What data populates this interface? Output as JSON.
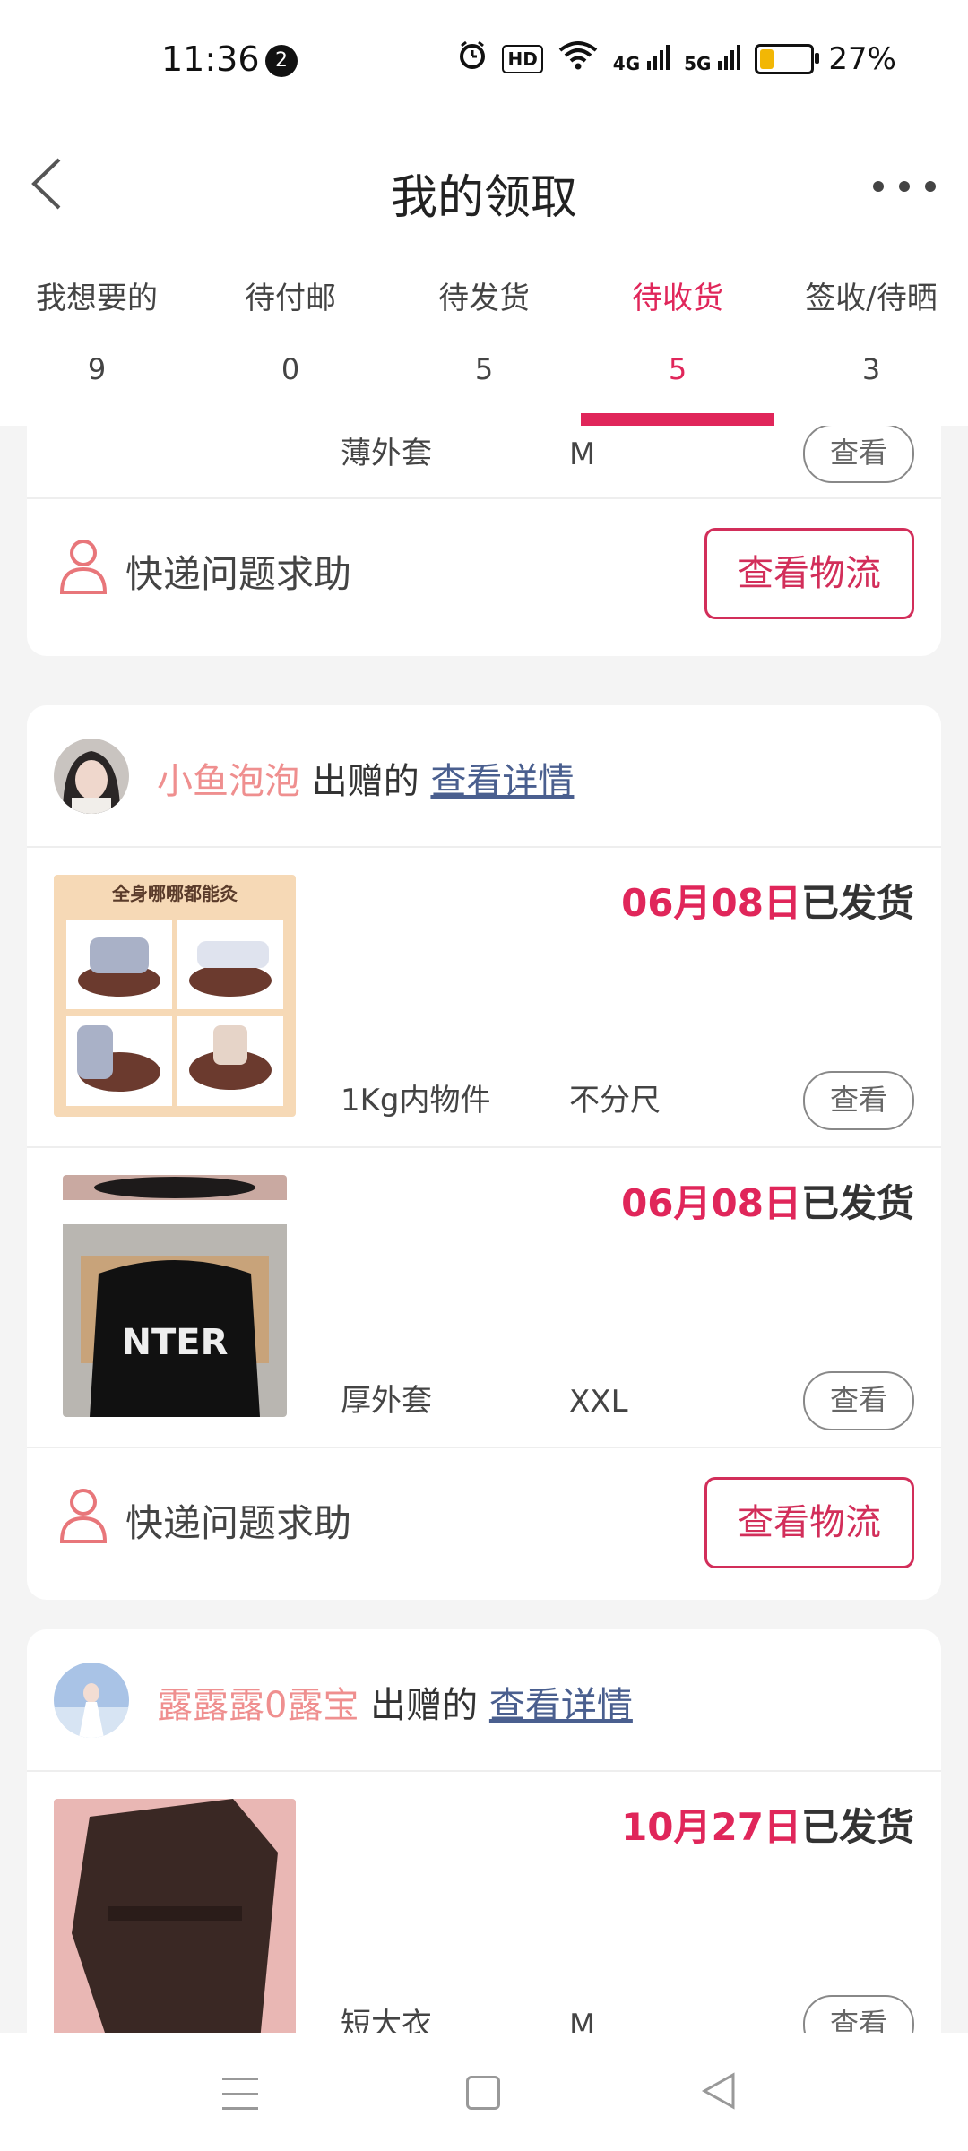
{
  "status_bar": {
    "time": "11:36",
    "notification_count": "2",
    "hd_label": "HD",
    "signal_4g": "4G",
    "signal_5g": "5G",
    "battery_percent": "27%",
    "battery_level": 0.27
  },
  "header": {
    "title": "我的领取"
  },
  "tabs": [
    {
      "label": "我想要的",
      "count": "9"
    },
    {
      "label": "待付邮",
      "count": "0"
    },
    {
      "label": "待发货",
      "count": "5"
    },
    {
      "label": "待收货",
      "count": "5",
      "active": true
    },
    {
      "label": "签收/待晒",
      "count": "3"
    }
  ],
  "colors": {
    "accent": "#e0265a",
    "giver_name": "#ef8f8f",
    "link": "#4a5f8f"
  },
  "cards": [
    {
      "items": [
        {
          "name": "薄外套",
          "size": "M",
          "view_label": "查看"
        }
      ],
      "help_text": "快递问题求助",
      "logistics_label": "查看物流"
    },
    {
      "giver_name": "小鱼泡泡",
      "giver_verb": "出赠的",
      "detail_link": "查看详情",
      "items": [
        {
          "date": "06月08日",
          "status": "已发货",
          "name": "1Kg内物件",
          "size": "不分尺",
          "view_label": "查看",
          "thumb_caption": "全身哪哪都能灸"
        },
        {
          "date": "06月08日",
          "status": "已发货",
          "name": "厚外套",
          "size": "XXL",
          "view_label": "查看",
          "thumb_caption": "NTER"
        }
      ],
      "help_text": "快递问题求助",
      "logistics_label": "查看物流"
    },
    {
      "giver_name": "露露露0露宝",
      "giver_verb": "出赠的",
      "detail_link": "查看详情",
      "items": [
        {
          "date": "10月27日",
          "status": "已发货",
          "name": "短大衣",
          "size": "M",
          "view_label": "查看"
        }
      ]
    }
  ]
}
